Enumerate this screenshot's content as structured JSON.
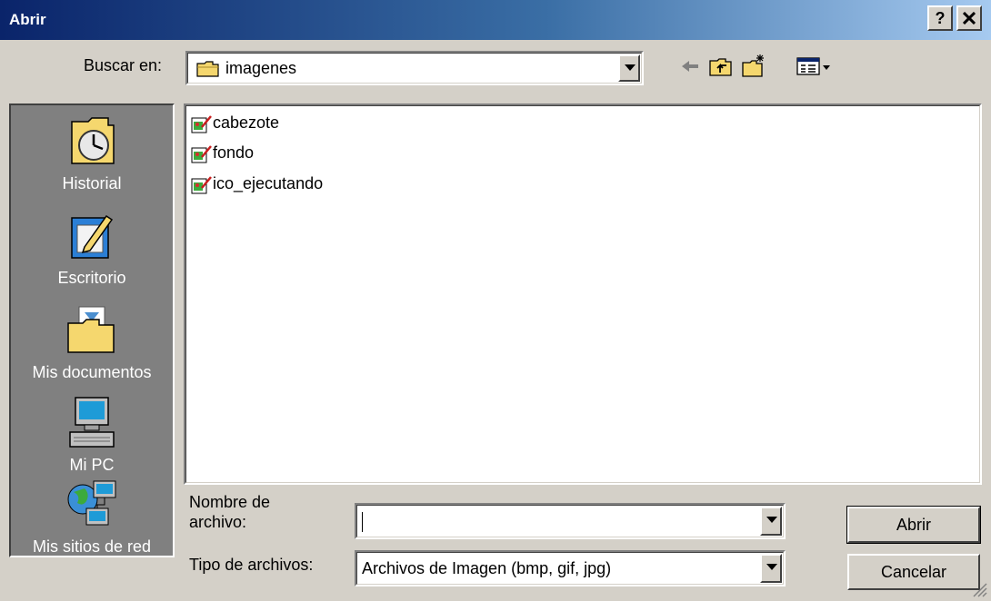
{
  "window": {
    "title": "Abrir",
    "help_label": "?",
    "close_label": "✕"
  },
  "lookin": {
    "label": "Buscar en:",
    "value": "imagenes",
    "icon": "folder-icon"
  },
  "toolbar": {
    "icons": [
      "back-arrow-icon",
      "up-one-level-icon",
      "new-folder-icon",
      "view-menu-icon"
    ]
  },
  "places": [
    {
      "label": "Historial",
      "icon": "history-icon"
    },
    {
      "label": "Escritorio",
      "icon": "desktop-icon"
    },
    {
      "label": "Mis documentos",
      "icon": "my-documents-icon"
    },
    {
      "label": "Mi PC",
      "icon": "my-computer-icon"
    },
    {
      "label": "Mis sitios de red",
      "icon": "network-places-icon"
    }
  ],
  "files": [
    {
      "name": "cabezote",
      "icon": "image-file-icon"
    },
    {
      "name": "fondo",
      "icon": "image-file-icon"
    },
    {
      "name": "ico_ejecutando",
      "icon": "image-file-icon"
    }
  ],
  "filename": {
    "label": "Nombre de\narchivo:",
    "value": ""
  },
  "filetype": {
    "label": "Tipo de archivos:",
    "value": "Archivos de Imagen (bmp, gif, jpg)"
  },
  "buttons": {
    "open": "Abrir",
    "cancel": "Cancelar"
  }
}
